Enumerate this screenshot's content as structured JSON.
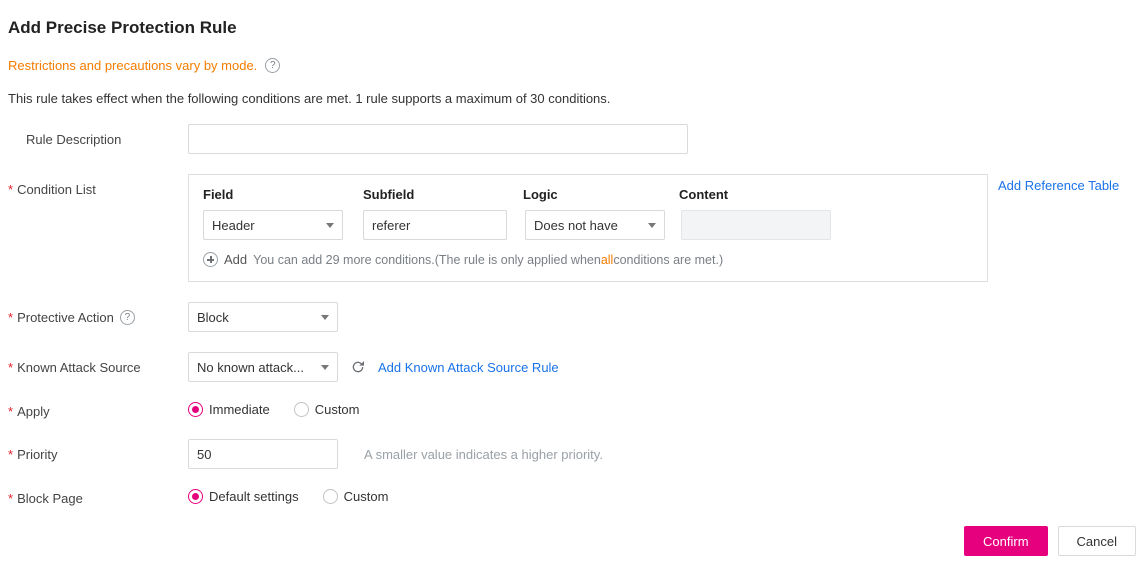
{
  "title": "Add Precise Protection Rule",
  "restriction_note": "Restrictions and precautions vary by mode.",
  "effect_note": "This rule takes effect when the following conditions are met. 1 rule supports a maximum of 30 conditions.",
  "labels": {
    "rule_description": "Rule Description",
    "condition_list": "Condition List",
    "protective_action": "Protective Action",
    "known_attack_source": "Known Attack Source",
    "apply": "Apply",
    "priority": "Priority",
    "block_page": "Block Page"
  },
  "condition": {
    "headers": {
      "field": "Field",
      "subfield": "Subfield",
      "logic": "Logic",
      "content": "Content"
    },
    "row": {
      "field": "Header",
      "subfield": "referer",
      "logic": "Does not have",
      "content": ""
    },
    "add_label": "Add",
    "add_hint_prefix": "You can add 29 more conditions.(The rule is only applied when ",
    "add_hint_all": "all",
    "add_hint_suffix": " conditions are met.)",
    "add_reference_table": "Add Reference Table"
  },
  "protective_action": {
    "value": "Block"
  },
  "known_attack_source": {
    "value": "No known attack...",
    "add_rule_link": "Add Known Attack Source Rule"
  },
  "apply": {
    "options": [
      "Immediate",
      "Custom"
    ],
    "selected": "Immediate"
  },
  "priority": {
    "value": "50",
    "hint": "A smaller value indicates a higher priority."
  },
  "block_page": {
    "options": [
      "Default settings",
      "Custom"
    ],
    "selected": "Default settings"
  },
  "footer": {
    "confirm": "Confirm",
    "cancel": "Cancel"
  }
}
